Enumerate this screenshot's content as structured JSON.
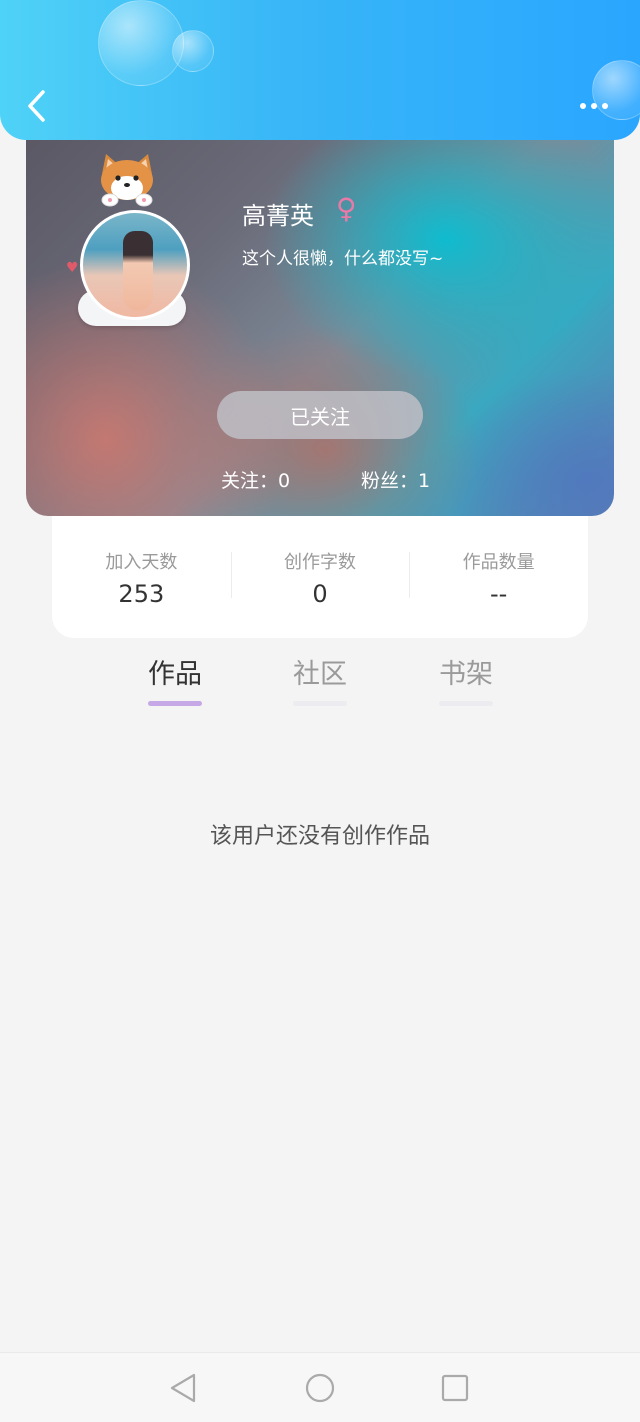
{
  "header": {
    "back_icon": "chevron-left-icon",
    "more_icon": "more-dots-icon"
  },
  "profile": {
    "name": "高菁英",
    "gender_symbol": "♀",
    "bio": "这个人很懒，什么都没写~",
    "follow_button": "已关注",
    "following_text": "关注：0",
    "fans_text": "粉丝：1"
  },
  "stats": [
    {
      "label": "加入天数",
      "value": "253"
    },
    {
      "label": "创作字数",
      "value": "0"
    },
    {
      "label": "作品数量",
      "value": "--"
    }
  ],
  "tabs": [
    {
      "label": "作品",
      "active": true
    },
    {
      "label": "社区",
      "active": false
    },
    {
      "label": "书架",
      "active": false
    }
  ],
  "empty_message": "该用户还没有创作作品",
  "colors": {
    "header_start": "#4fd2f7",
    "header_end": "#2aa6ff",
    "tab_indicator": "#c6a8e6",
    "gender_icon": "#e97aa7"
  },
  "system_nav": {
    "back": "triangle-back-icon",
    "home": "circle-home-icon",
    "recent": "square-recent-icon"
  }
}
